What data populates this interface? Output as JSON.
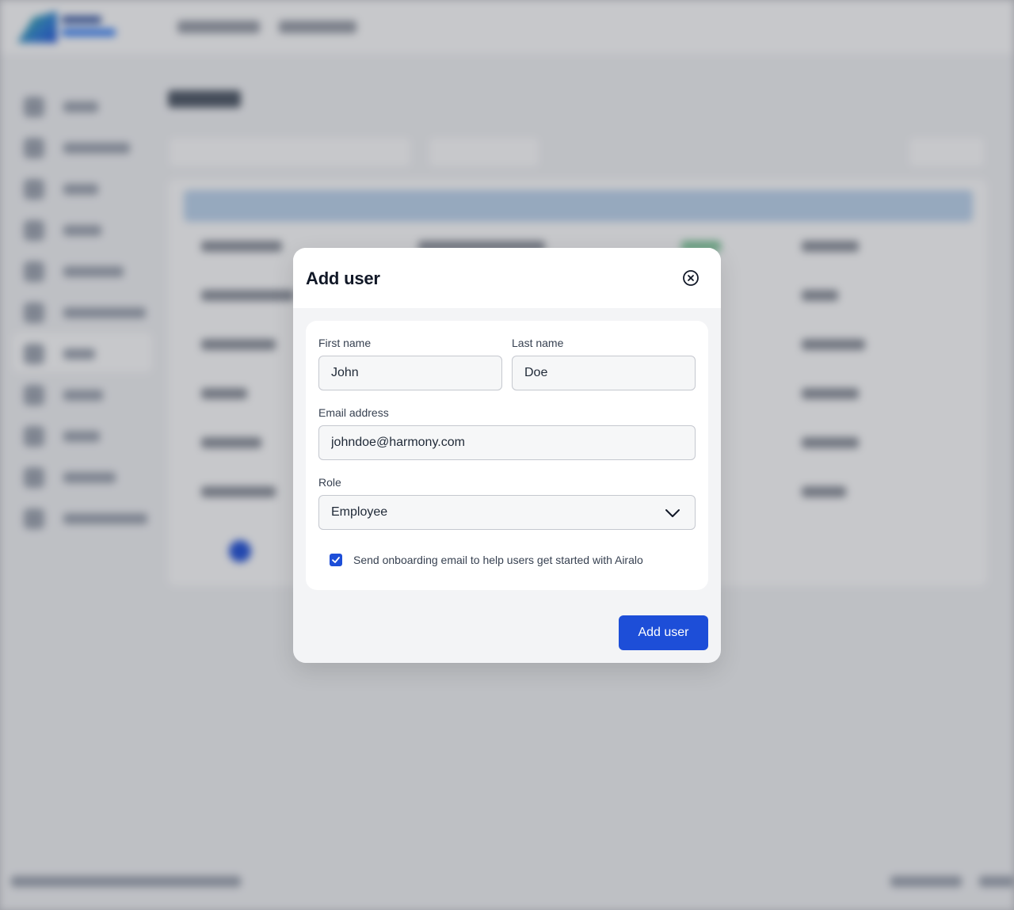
{
  "modal": {
    "title": "Add user",
    "close_icon": "close-circle-icon",
    "first_name": {
      "label": "First name",
      "value": "John"
    },
    "last_name": {
      "label": "Last name",
      "value": "Doe"
    },
    "email": {
      "label": "Email address",
      "value": "johndoe@harmony.com"
    },
    "role": {
      "label": "Role",
      "value": "Employee",
      "icon": "chevron-down-icon"
    },
    "onboarding": {
      "label": "Send onboarding email to help users get started with Airalo",
      "checked": true
    },
    "submit_label": "Add user"
  },
  "colors": {
    "primary": "#1d4ed8",
    "modal_bg": "#f3f4f6",
    "overlay": "#c4c5ca"
  }
}
